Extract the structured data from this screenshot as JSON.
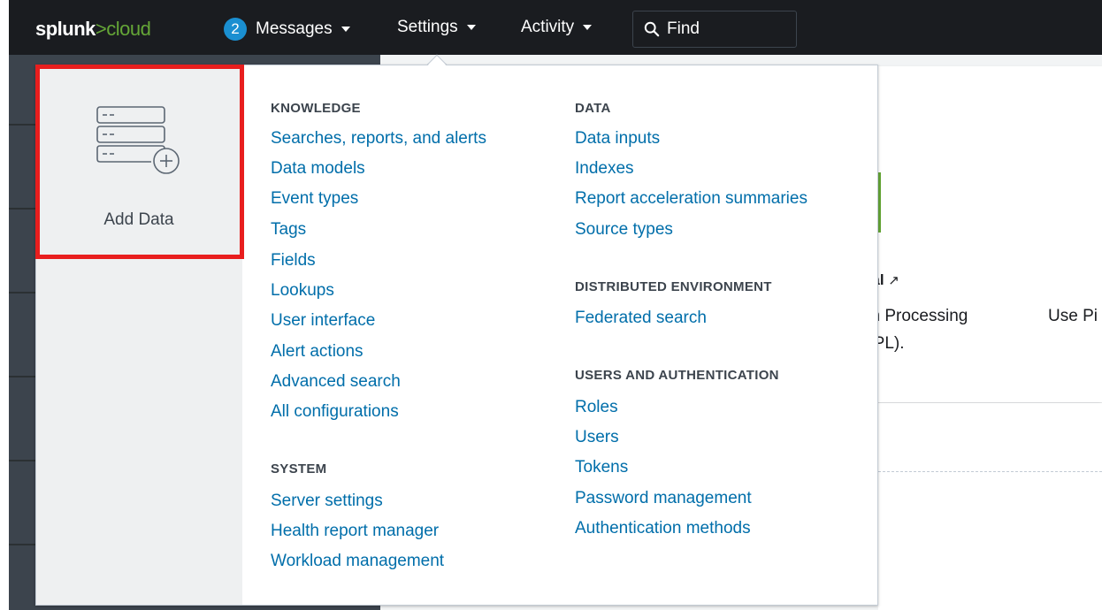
{
  "topbar": {
    "logo_main": "splunk",
    "logo_sep": ">",
    "logo_suffix": "cloud",
    "messages_count": "2",
    "messages_label": "Messages",
    "settings_label": "Settings",
    "activity_label": "Activity",
    "find_label": "Find"
  },
  "dropdown": {
    "add_data_label": "Add Data",
    "knowledge": {
      "title": "KNOWLEDGE",
      "items": [
        "Searches, reports, and alerts",
        "Data models",
        "Event types",
        "Tags",
        "Fields",
        "Lookups",
        "User interface",
        "Alert actions",
        "Advanced search",
        "All configurations"
      ]
    },
    "system": {
      "title": "SYSTEM",
      "items": [
        "Server settings",
        "Health report manager",
        "Workload management"
      ]
    },
    "data": {
      "title": "DATA",
      "items": [
        "Data inputs",
        "Indexes",
        "Report acceleration summaries",
        "Source types"
      ]
    },
    "distributed": {
      "title": "DISTRIBUTED ENVIRONMENT",
      "items": [
        "Federated search"
      ]
    },
    "users": {
      "title": "USERS AND AUTHENTICATION",
      "items": [
        "Roles",
        "Users",
        "Tokens",
        "Password management",
        "Authentication methods"
      ]
    }
  },
  "background": {
    "text1": "ual",
    "text2": "ch Processing",
    "text3": "SPL).",
    "text4": "Use Pi"
  },
  "colors": {
    "topbar": "#1a1c20",
    "link": "#006eaa",
    "highlight": "#e81e1e",
    "badge": "#1a8fd1",
    "brand_green": "#65a637"
  }
}
